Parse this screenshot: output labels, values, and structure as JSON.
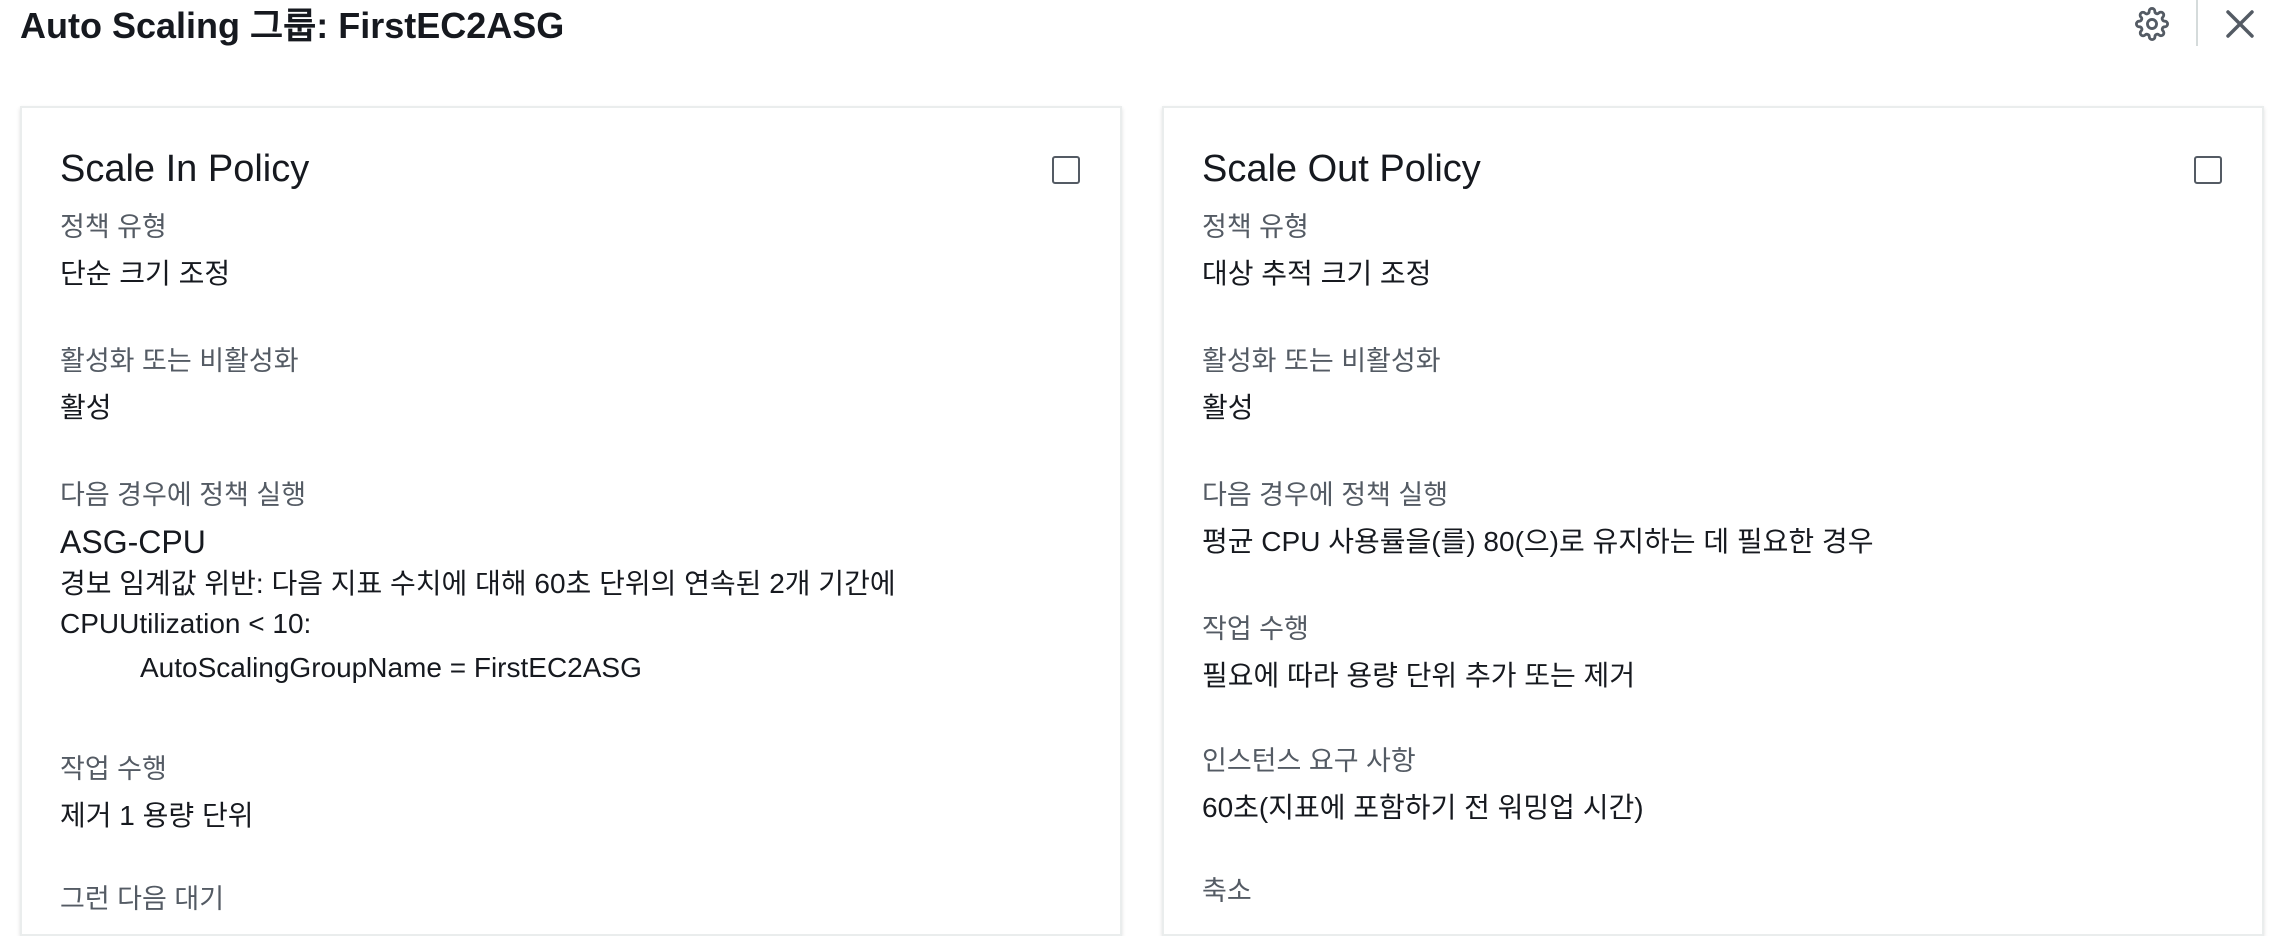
{
  "header": {
    "title": "Auto Scaling 그룹: FirstEC2ASG",
    "settings_icon": "gear-icon",
    "close_icon": "close-icon"
  },
  "scale_in": {
    "title": "Scale In Policy",
    "policy_type_label": "정책 유형",
    "policy_type_value": "단순 크기 조정",
    "enabled_label": "활성화 또는 비활성화",
    "enabled_value": "활성",
    "run_when_label": "다음 경우에 정책 실행",
    "alarm_name": "ASG-CPU",
    "alarm_breach": "경보 임계값 위반: 다음 지표 수치에 대해 60초 단위의 연속된 2개 기간에",
    "alarm_condition": "CPUUtilization < 10:",
    "alarm_dimension": "AutoScalingGroupName = FirstEC2ASG",
    "action_label": "작업 수행",
    "action_value": "제거 1 용량 단위",
    "next_label": "그런 다음 대기"
  },
  "scale_out": {
    "title": "Scale Out Policy",
    "policy_type_label": "정책 유형",
    "policy_type_value": "대상 추적 크기 조정",
    "enabled_label": "활성화 또는 비활성화",
    "enabled_value": "활성",
    "run_when_label": "다음 경우에 정책 실행",
    "run_when_value": "평균 CPU 사용률을(를) 80(으)로 유지하는 데 필요한 경우",
    "action_label": "작업 수행",
    "action_value": "필요에 따라 용량 단위 추가 또는 제거",
    "instance_req_label": "인스턴스 요구 사항",
    "instance_req_value": "60초(지표에 포함하기 전 워밍업 시간)",
    "scale_in_label": "축소"
  }
}
